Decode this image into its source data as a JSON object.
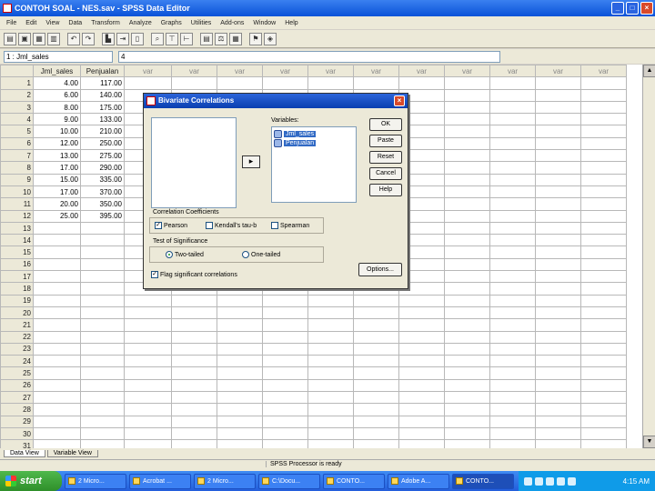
{
  "window": {
    "title": "CONTOH SOAL - NES.sav - SPSS Data Editor",
    "minimize": "_",
    "maximize": "□",
    "close": "×"
  },
  "menu": [
    "File",
    "Edit",
    "View",
    "Data",
    "Transform",
    "Analyze",
    "Graphs",
    "Utilities",
    "Add-ons",
    "Window",
    "Help"
  ],
  "cell_ref": {
    "name": "1 : Jml_sales",
    "value": "4"
  },
  "grid": {
    "columns": [
      "Jml_sales",
      "Penjualan",
      "var",
      "var",
      "var",
      "var",
      "var",
      "var",
      "var",
      "var",
      "var",
      "var",
      "var"
    ],
    "rows": [
      [
        "4.00",
        "117.00"
      ],
      [
        "6.00",
        "140.00"
      ],
      [
        "8.00",
        "175.00"
      ],
      [
        "9.00",
        "133.00"
      ],
      [
        "10.00",
        "210.00"
      ],
      [
        "12.00",
        "250.00"
      ],
      [
        "13.00",
        "275.00"
      ],
      [
        "17.00",
        "290.00"
      ],
      [
        "15.00",
        "335.00"
      ],
      [
        "17.00",
        "370.00"
      ],
      [
        "20.00",
        "350.00"
      ],
      [
        "25.00",
        "395.00"
      ]
    ],
    "row_count": 31
  },
  "tabs": {
    "data_view": "Data View",
    "variable_view": "Variable View"
  },
  "status": "SPSS Processor  is ready",
  "dialog": {
    "title": "Bivariate Correlations",
    "variables_label": "Variables:",
    "variables": [
      "Jml_sales",
      "Penjualan"
    ],
    "move_arrow": "▸",
    "buttons": [
      "OK",
      "Paste",
      "Reset",
      "Cancel",
      "Help"
    ],
    "coef_label": "Correlation Coefficients",
    "coef": {
      "pearson": "Pearson",
      "kendall": "Kendall's tau-b",
      "spearman": "Spearman"
    },
    "sig_label": "Test of Significance",
    "sig": {
      "two": "Two-tailed",
      "one": "One-tailed"
    },
    "flag": "Flag significant correlations",
    "options": "Options..."
  },
  "taskbar": {
    "start": "start",
    "items": [
      "2 Micro...",
      "Acrobat ...",
      "2 Micro...",
      "C:\\Docu...",
      "CONTO...",
      "Adobe A...",
      "CONTO..."
    ],
    "clock": "4:15 AM"
  }
}
